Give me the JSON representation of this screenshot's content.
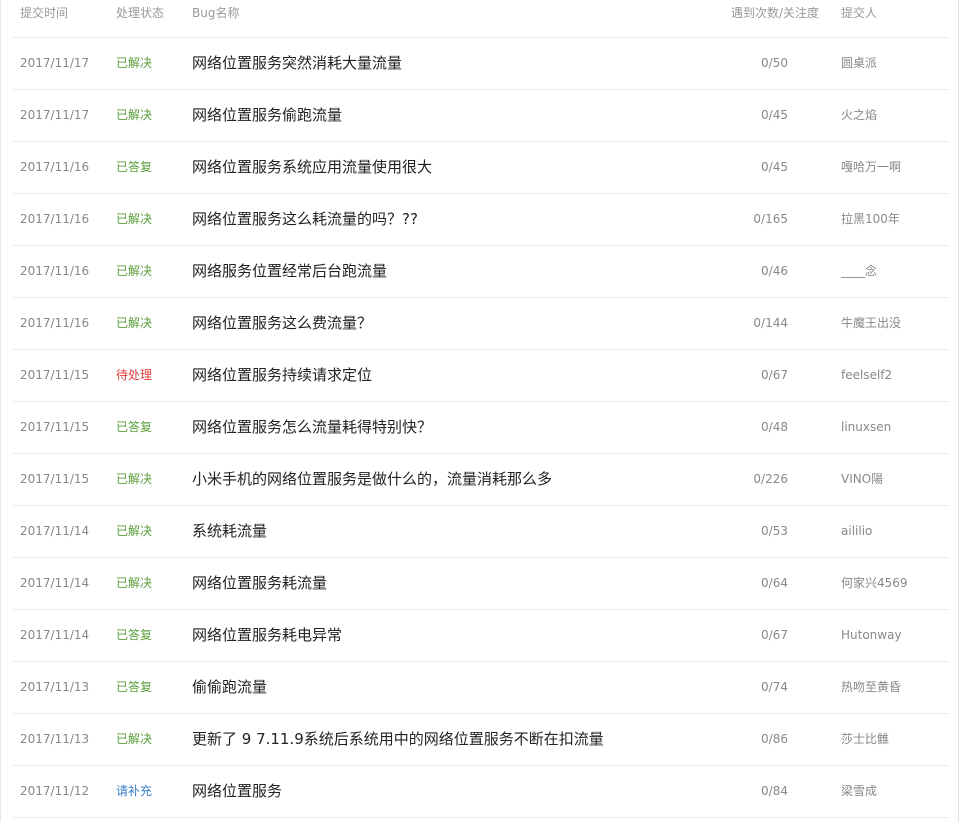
{
  "colors": {
    "resolved": "#5a9e3a",
    "answered": "#5a9e3a",
    "pending": "#e03c3c",
    "needs_info": "#3a7ec9",
    "header_text": "#999999",
    "title_text": "#222222"
  },
  "table": {
    "headers": {
      "date": "提交时间",
      "status": "处理状态",
      "name": "Bug名称",
      "count": "遇到次数/关注度",
      "user": "提交人"
    },
    "rows": [
      {
        "date": "2017/11/17",
        "status": "已解决",
        "status_kind": "resolved",
        "name": "网络位置服务突然消耗大量流量",
        "count": "0/50",
        "user": "圆桌派"
      },
      {
        "date": "2017/11/17",
        "status": "已解决",
        "status_kind": "resolved",
        "name": "网络位置服务偷跑流量",
        "count": "0/45",
        "user": "火之焰"
      },
      {
        "date": "2017/11/16",
        "status": "已答复",
        "status_kind": "answered",
        "name": "网络位置服务系统应用流量使用很大",
        "count": "0/45",
        "user": "嘎哈万一啊"
      },
      {
        "date": "2017/11/16",
        "status": "已解决",
        "status_kind": "resolved",
        "name": "网络位置服务这么耗流量的吗？??",
        "count": "0/165",
        "user": "拉黑100年"
      },
      {
        "date": "2017/11/16",
        "status": "已解决",
        "status_kind": "resolved",
        "name": "网络服务位置经常后台跑流量",
        "count": "0/46",
        "user": "____念"
      },
      {
        "date": "2017/11/16",
        "status": "已解决",
        "status_kind": "resolved",
        "name": "网络位置服务这么费流量？",
        "count": "0/144",
        "user": "牛魔王出没"
      },
      {
        "date": "2017/11/15",
        "status": "待处理",
        "status_kind": "pending",
        "name": "网络位置服务持续请求定位",
        "count": "0/67",
        "user": "feelself2"
      },
      {
        "date": "2017/11/15",
        "status": "已答复",
        "status_kind": "answered",
        "name": "网络位置服务怎么流量耗得特别快？",
        "count": "0/48",
        "user": "linuxsen"
      },
      {
        "date": "2017/11/15",
        "status": "已解决",
        "status_kind": "resolved",
        "name": "小米手机的网络位置服务是做什么的，流量消耗那么多",
        "count": "0/226",
        "user": "VINO陽"
      },
      {
        "date": "2017/11/14",
        "status": "已解决",
        "status_kind": "resolved",
        "name": "系统耗流量",
        "count": "0/53",
        "user": "aililio"
      },
      {
        "date": "2017/11/14",
        "status": "已解决",
        "status_kind": "resolved",
        "name": "网络位置服务耗流量",
        "count": "0/64",
        "user": "何家兴4569"
      },
      {
        "date": "2017/11/14",
        "status": "已答复",
        "status_kind": "answered",
        "name": "网络位置服务耗电异常",
        "count": "0/67",
        "user": "Hutonway"
      },
      {
        "date": "2017/11/13",
        "status": "已答复",
        "status_kind": "answered",
        "name": "偷偷跑流量",
        "count": "0/74",
        "user": "热吻至黄昏"
      },
      {
        "date": "2017/11/13",
        "status": "已解决",
        "status_kind": "resolved",
        "name": "更新了 9 7.11.9系统后系统用中的网络位置服务不断在扣流量",
        "count": "0/86",
        "user": "莎士比雔"
      },
      {
        "date": "2017/11/12",
        "status": "请补充",
        "status_kind": "needs_info",
        "name": "网络位置服务",
        "count": "0/84",
        "user": "梁雪成"
      }
    ]
  }
}
